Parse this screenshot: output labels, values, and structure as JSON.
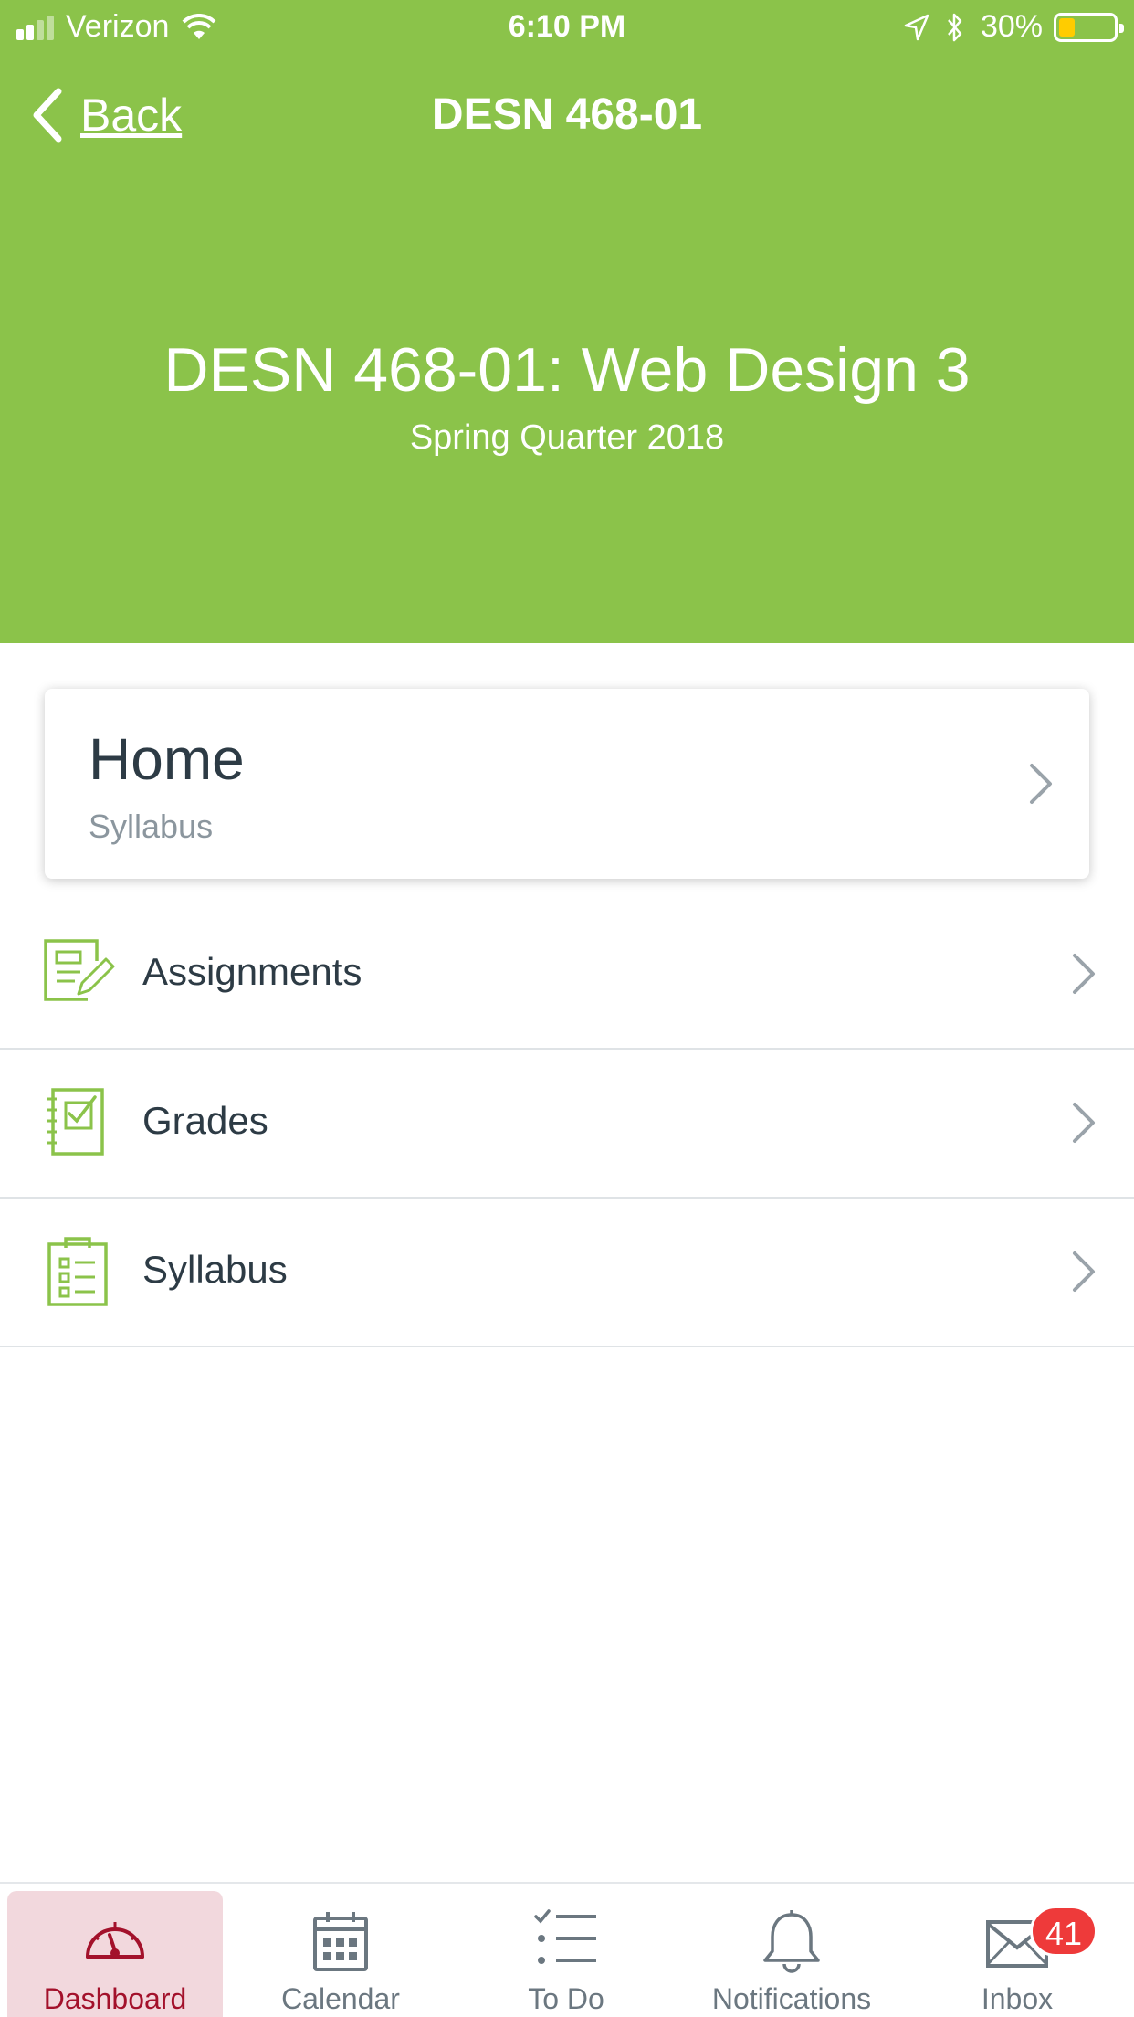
{
  "status_bar": {
    "carrier": "Verizon",
    "time": "6:10 PM",
    "battery": "30%",
    "battery_level": 0.3,
    "icons": [
      "signal-icon",
      "wifi-icon",
      "location-icon",
      "bluetooth-icon",
      "battery-icon"
    ]
  },
  "nav": {
    "back_label": "Back",
    "title": "DESN 468-01"
  },
  "course": {
    "title": "DESN 468-01:  Web Design 3",
    "term": "Spring Quarter 2018"
  },
  "home_card": {
    "title": "Home",
    "subtitle": "Syllabus"
  },
  "menu": [
    {
      "label": "Assignments",
      "icon": "assignments-icon"
    },
    {
      "label": "Grades",
      "icon": "grades-icon"
    },
    {
      "label": "Syllabus",
      "icon": "syllabus-icon"
    }
  ],
  "tabbar": {
    "tabs": [
      {
        "label": "Dashboard",
        "icon": "dashboard-icon",
        "active": true
      },
      {
        "label": "Calendar",
        "icon": "calendar-icon"
      },
      {
        "label": "To Do",
        "icon": "todo-icon"
      },
      {
        "label": "Notifications",
        "icon": "bell-icon"
      },
      {
        "label": "Inbox",
        "icon": "mail-icon",
        "badge": "41"
      }
    ]
  },
  "colors": {
    "header": "#8bc34a",
    "accent_active": "#a3112b",
    "active_tab_bg": "#f2d8dd",
    "badge": "#ee3a3a",
    "icon_green": "#8bc34a"
  }
}
